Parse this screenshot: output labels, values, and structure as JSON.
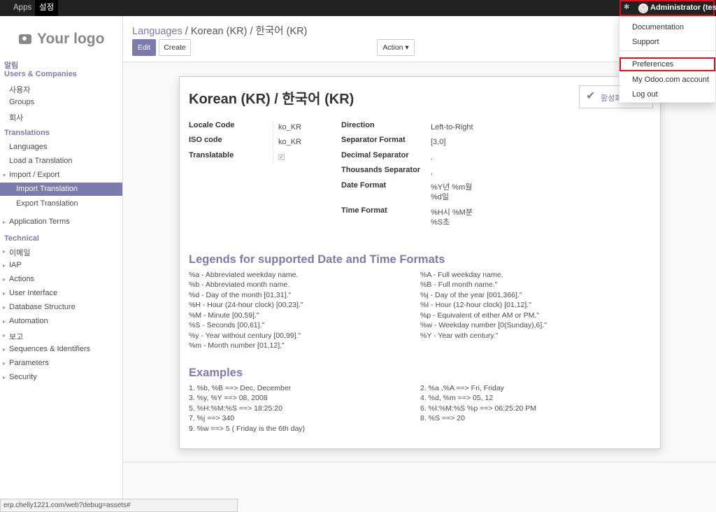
{
  "topbar": {
    "apps_label": "Apps",
    "settings_label": "설정",
    "user_label": "Administrator (test)"
  },
  "sidebar": {
    "logo_text": "Your logo",
    "sections": [
      {
        "title": "알림",
        "subtitle": "Users & Companies",
        "items": [
          "사용자",
          "Groups",
          "회사"
        ]
      },
      {
        "title": "Translations",
        "items": [
          "Languages",
          "Load a Translation",
          "Import / Export",
          "Import Translation",
          "Export Translation",
          "Application Terms"
        ]
      },
      {
        "title": "Technical",
        "items": [
          "이메일",
          "IAP",
          "Actions",
          "User Interface",
          "Database Structure",
          "Automation",
          "보고",
          "Sequences & Identifiers",
          "Parameters",
          "Security"
        ]
      }
    ],
    "active_item": "Import Translation"
  },
  "control_panel": {
    "breadcrumb_link": "Languages",
    "breadcrumb_sep": "/",
    "breadcrumb_current": "Korean (KR) / 한국어 (KR)",
    "edit_label": "Edit",
    "create_label": "Create",
    "action_label": "Action ▾"
  },
  "form": {
    "title": "Korean (KR) / 한국어 (KR)",
    "active_button_label": "활성화",
    "left_fields": [
      {
        "label": "Locale Code",
        "value": "ko_KR"
      },
      {
        "label": "ISO code",
        "value": "ko_KR"
      },
      {
        "label": "Translatable",
        "value": "checked"
      }
    ],
    "right_fields": [
      {
        "label": "Direction",
        "value": "Left-to-Right"
      },
      {
        "label": "Separator Format",
        "value": "[3,0]"
      },
      {
        "label": "Decimal Separator",
        "value": "."
      },
      {
        "label": "Thousands Separator",
        "value": ","
      },
      {
        "label": "Date Format",
        "value": "%Y년 %m월\n%d일"
      },
      {
        "label": "Time Format",
        "value": "%H시 %M분\n%S초"
      }
    ]
  },
  "legends": {
    "title": "Legends for supported Date and Time Formats",
    "left": [
      "%a - Abbreviated weekday name.",
      "%b - Abbreviated month name.",
      "%d - Day of the month [01,31].\"",
      "%H - Hour (24-hour clock) [00,23].\"",
      "%M - Minute [00,59].\"",
      "%S - Seconds [00,61].\"",
      "%y - Year without century [00,99].\"",
      "%m - Month number [01,12].\""
    ],
    "right": [
      "%A - Full weekday name.",
      "%B - Full month name.\"",
      "%j - Day of the year [001,366].\"",
      "%I - Hour (12-hour clock) [01,12].\"",
      "%p - Equivalent of either AM or PM.\"",
      "%w - Weekday number [0(Sunday),6].\"",
      "%Y - Year with century.\""
    ]
  },
  "examples": {
    "title": "Examples",
    "left": [
      "1. %b, %B ==> Dec, December",
      "3. %y, %Y ==> 08, 2008",
      "5. %H:%M:%S ==> 18:25:20",
      "7. %j ==> 340",
      "9. %w ==> 5 ( Friday is the 6th day)"
    ],
    "right": [
      "2. %a ,%A ==> Fri, Friday",
      "4. %d, %m ==> 05, 12",
      "6. %I:%M:%S %p ==> 06:25:20 PM",
      "8. %S ==> 20"
    ]
  },
  "user_menu": {
    "items": [
      "Documentation",
      "Support",
      "Preferences",
      "My Odoo.com account",
      "Log out"
    ],
    "highlighted": "Preferences"
  },
  "statusbar": {
    "url": "erp.chelly1221.com/web?debug=assets#"
  },
  "colors": {
    "accent": "#7c7bad",
    "topbar": "#222222",
    "highlight_border": "#e0101a"
  }
}
